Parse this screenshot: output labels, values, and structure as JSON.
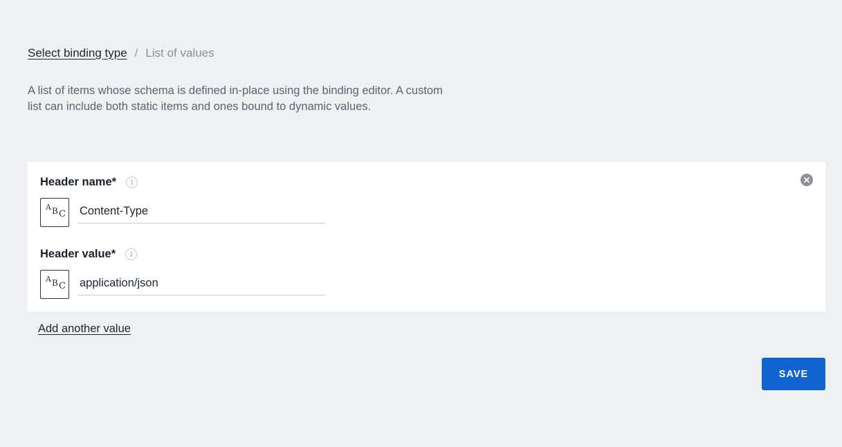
{
  "breadcrumb": {
    "link_label": "Select binding type",
    "separator": "/",
    "current_label": "List of values"
  },
  "description": "A list of items whose schema is defined in-place using the binding editor. A custom list can include both static items and ones bound to dynamic values.",
  "item": {
    "fields": [
      {
        "label": "Header name*",
        "type_icon": "text-type-icon",
        "value": "Content-Type"
      },
      {
        "label": "Header value*",
        "type_icon": "text-type-icon",
        "value": "application/json"
      }
    ],
    "remove_icon": "close-circle-icon",
    "info_icon": "info-icon"
  },
  "add_link_label": "Add another value",
  "save_label": "SAVE",
  "colors": {
    "background": "#eff0f2",
    "card": "#ffffff",
    "primary": "#0f64d2",
    "muted_text": "#5c6270"
  }
}
